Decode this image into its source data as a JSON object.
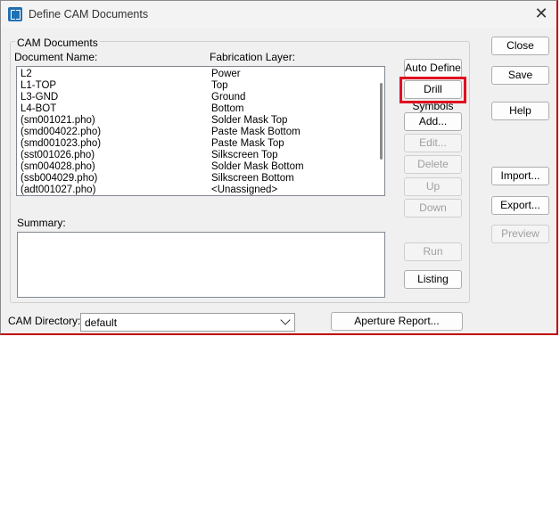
{
  "window": {
    "title": "Define CAM Documents"
  },
  "group": {
    "label": "CAM Documents"
  },
  "list": {
    "header_name": "Document Name:",
    "header_layer": "Fabrication Layer:",
    "rows": [
      {
        "name": "L2",
        "layer": "Power"
      },
      {
        "name": "L1-TOP",
        "layer": "Top"
      },
      {
        "name": "L3-GND",
        "layer": "Ground"
      },
      {
        "name": "L4-BOT",
        "layer": "Bottom"
      },
      {
        "name": "(sm001021.pho)",
        "layer": "Solder Mask Top"
      },
      {
        "name": "(smd004022.pho)",
        "layer": "Paste Mask Bottom"
      },
      {
        "name": "(smd001023.pho)",
        "layer": "Paste Mask Top"
      },
      {
        "name": "(sst001026.pho)",
        "layer": "Silkscreen Top"
      },
      {
        "name": "(sm004028.pho)",
        "layer": "Solder Mask Bottom"
      },
      {
        "name": "(ssb004029.pho)",
        "layer": "Silkscreen Bottom"
      },
      {
        "name": "(adt001027.pho)",
        "layer": "<Unassigned>"
      }
    ]
  },
  "summary": {
    "label": "Summary:"
  },
  "buttons": {
    "auto_define": "Auto Define",
    "drill_symbols": "Drill Symbols",
    "add": "Add...",
    "edit": "Edit...",
    "delete": "Delete",
    "up": "Up",
    "down": "Down",
    "run": "Run",
    "listing": "Listing",
    "close": "Close",
    "save": "Save",
    "help": "Help",
    "import": "Import...",
    "export": "Export...",
    "preview": "Preview",
    "aperture_report": "Aperture Report..."
  },
  "cam_directory": {
    "label": "CAM Directory:",
    "value": "default"
  },
  "colors": {
    "highlight": "#e01020",
    "accent": "#1f6fb3"
  }
}
